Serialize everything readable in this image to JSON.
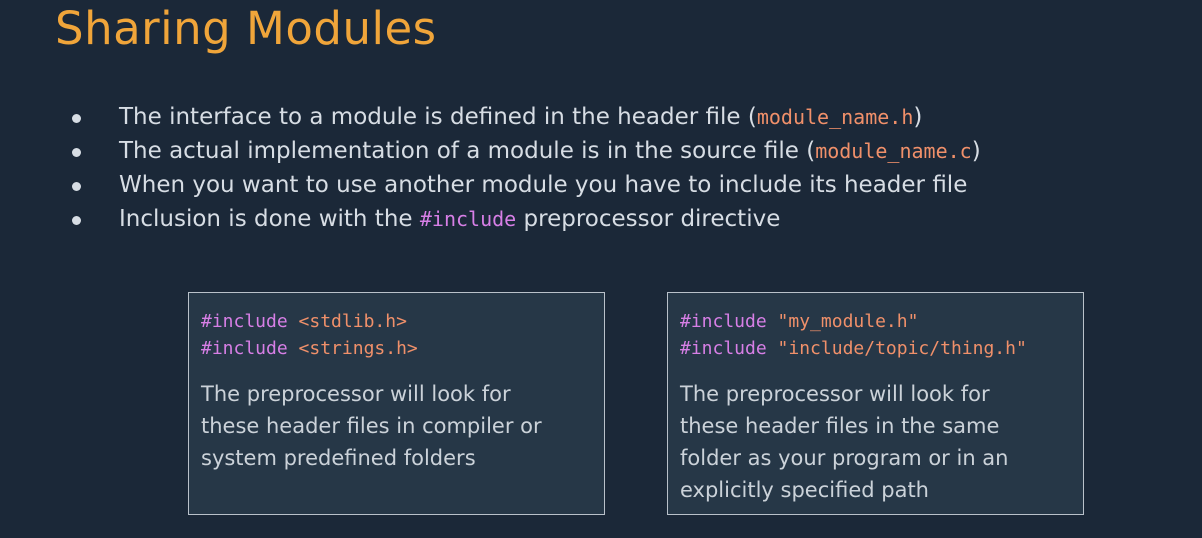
{
  "title": "Sharing Modules",
  "bullets": [
    {
      "before": "The interface to a module is defined in the header file (",
      "code": "module_name.h",
      "after": ")"
    },
    {
      "before": "The actual implementation of a module is in the source file (",
      "code": "module_name.c",
      "after": ")"
    },
    {
      "before": "When you want to use another module you have to include its header file",
      "code": "",
      "after": ""
    },
    {
      "before": "Inclusion is done with the ",
      "code": "#include",
      "after": " preprocessor directive"
    }
  ],
  "boxes": {
    "system": {
      "lines": [
        {
          "directive": "#include",
          "target": "<stdlib.h>"
        },
        {
          "directive": "#include",
          "target": "<strings.h>"
        }
      ],
      "description": "The preprocessor will look for\nthese header files in compiler or\nsystem predefined folders"
    },
    "local": {
      "lines": [
        {
          "directive": "#include",
          "target": "\"my_module.h\""
        },
        {
          "directive": "#include",
          "target": "\"include/topic/thing.h\""
        }
      ],
      "description": "The preprocessor will look for\nthese header files in the same\nfolder as your program or in an\nexplicitly specified path"
    }
  },
  "colors": {
    "background": "#1b2838",
    "title": "#f0a53a",
    "code_string": "#f0906a",
    "code_keyword": "#d77fe6",
    "box_background": "#263747",
    "box_border": "#b9c1ca"
  }
}
